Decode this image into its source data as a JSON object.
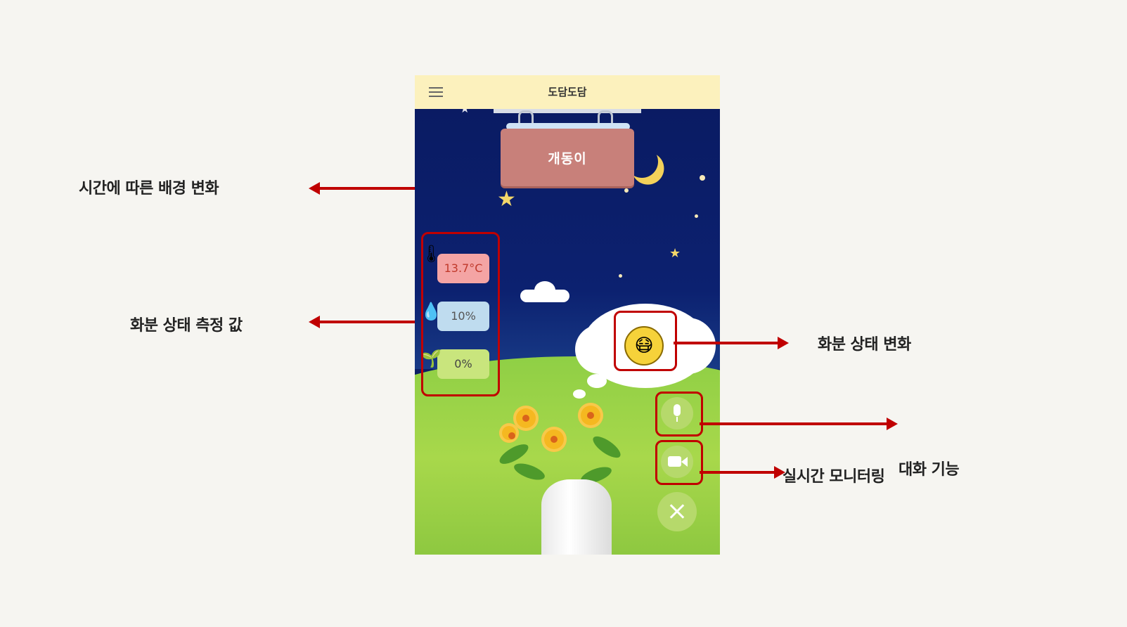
{
  "app": {
    "title": "도담도담",
    "plant_name": "개동이"
  },
  "stats": {
    "temperature": "13.7°C",
    "water": "10%",
    "soil": "0%"
  },
  "annotations": {
    "background": "시간에 따른 배경 변화",
    "measurements": "화분 상태 측정 값",
    "plant_status": "화분 상태 변화",
    "monitoring": "실시간 모니터링",
    "chat": "대화 기능"
  },
  "icons": {
    "menu": "hamburger-menu-icon",
    "temperature": "thermometer-icon",
    "water": "water-drop-icon",
    "soil": "sprout-icon",
    "status": "sneezing-face-icon",
    "mic": "microphone-icon",
    "camera": "video-camera-icon",
    "close": "close-icon"
  },
  "colors": {
    "highlight": "#c00000",
    "appbar": "#fcf1bd",
    "sky": "#0b1f66",
    "button": "#b6d96b"
  }
}
